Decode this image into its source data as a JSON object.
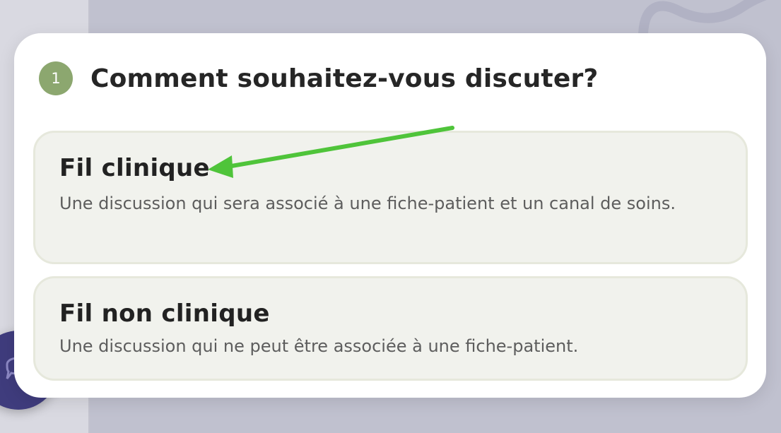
{
  "step": {
    "number": "1",
    "title": "Comment souhaitez-vous discuter?"
  },
  "options": [
    {
      "title": "Fil clinique",
      "description": "Une discussion qui sera associé à une fiche-patient et un canal de soins."
    },
    {
      "title": "Fil non clinique",
      "description": "Une discussion qui ne peut être associée à une fiche-patient."
    }
  ],
  "icons": {
    "chat_fab": "chat-bubble-icon",
    "annotation": "arrow-icon"
  },
  "colors": {
    "backdrop": "#c0c1cf",
    "sidebar": "#d9d9e1",
    "dialog": "#ffffff",
    "badge": "#8ca76f",
    "card": "#f1f2ed",
    "card_border": "#e6e8dc",
    "title_text": "#262626",
    "desc_text": "#5d5d5d",
    "fab": "#3f3c7d",
    "annotation_arrow": "#4fc43a"
  }
}
